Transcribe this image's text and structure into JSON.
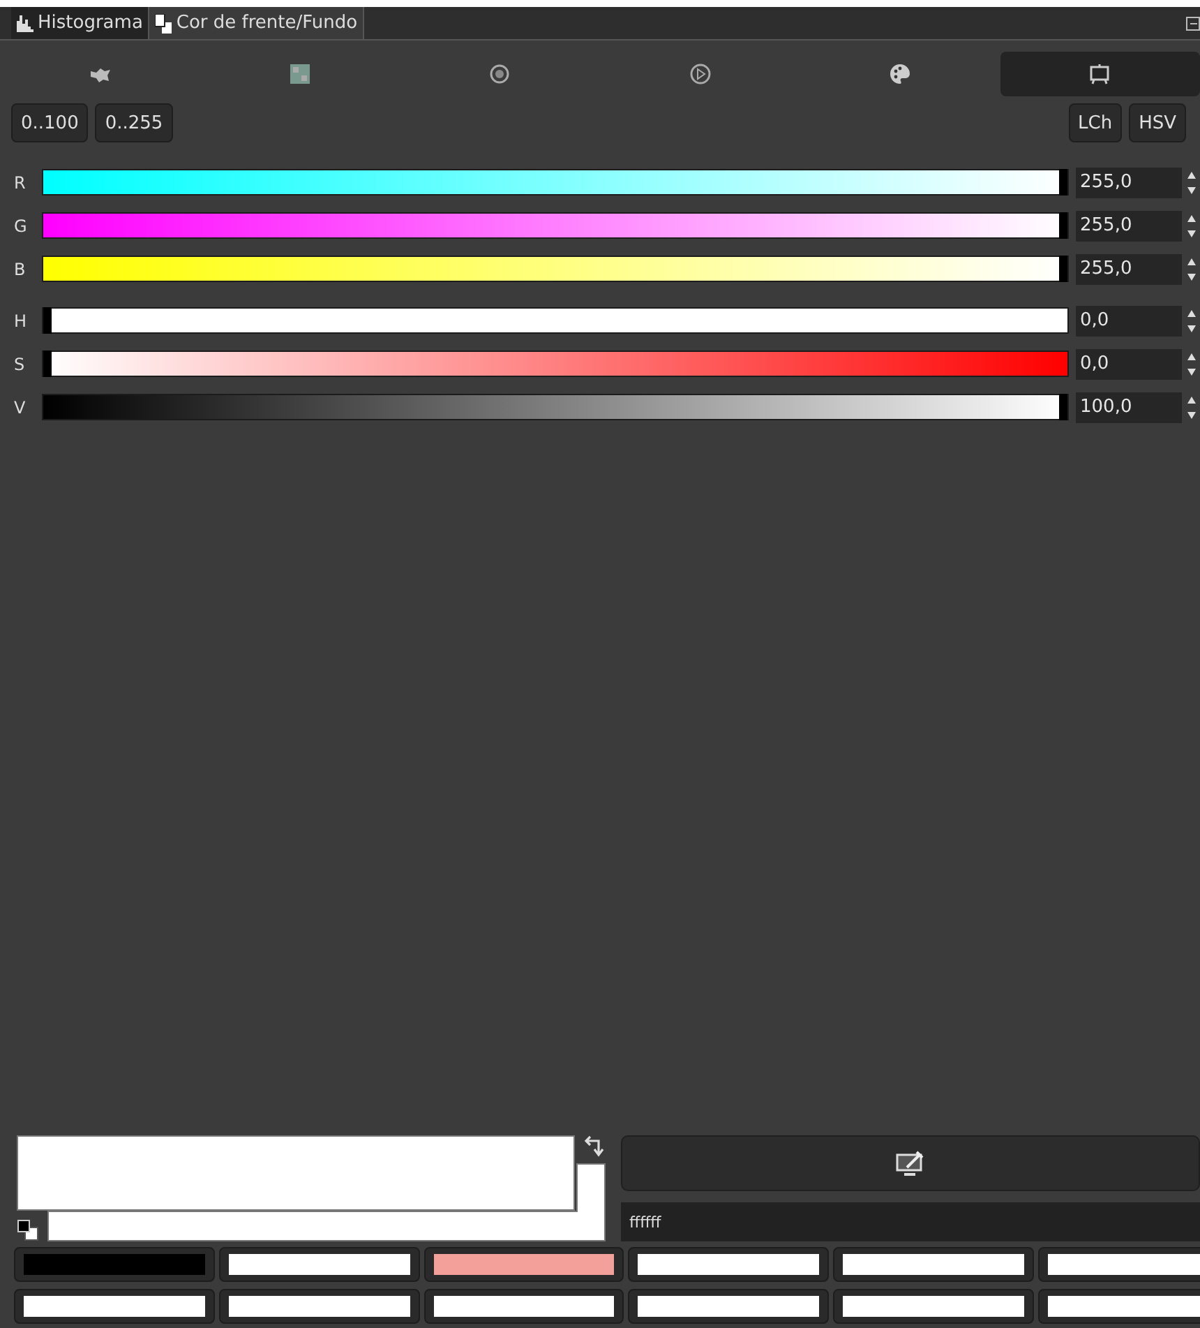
{
  "tabs": [
    {
      "label": "Histograma",
      "selected": false
    },
    {
      "label": "Cor de frente/Fundo",
      "selected": true
    }
  ],
  "selector_tabs": [
    {
      "selected": false
    },
    {
      "selected": false
    },
    {
      "selected": false
    },
    {
      "selected": false
    },
    {
      "selected": false
    },
    {
      "selected": true
    }
  ],
  "range_buttons": [
    "0..100",
    "0..255"
  ],
  "model_buttons": [
    "LCh",
    "HSV"
  ],
  "sliders": [
    {
      "label": "R",
      "value": "255,0",
      "level": 1
    },
    {
      "label": "G",
      "value": "255,0",
      "level": 1
    },
    {
      "label": "B",
      "value": "255,0",
      "level": 1
    },
    {
      "label": "H",
      "value": "0,0",
      "level": 0
    },
    {
      "label": "S",
      "value": "0,0",
      "level": 0
    },
    {
      "label": "V",
      "value": "100,0",
      "level": 1
    }
  ],
  "foreground": {
    "color": "#ffffff"
  },
  "background": {
    "color": "#ffffff"
  },
  "hex_field": {
    "value": "ffffff"
  },
  "history": [
    {
      "color": "#000000"
    },
    {
      "color": "#ffffff"
    },
    {
      "color": "#f4a09a"
    },
    {
      "color": "#ffffff"
    },
    {
      "color": "#ffffff"
    },
    {
      "color": "#ffffff"
    },
    {
      "color": "#ffffff"
    },
    {
      "color": "#ffffff"
    },
    {
      "color": "#ffffff"
    },
    {
      "color": "#ffffff"
    },
    {
      "color": "#ffffff"
    },
    {
      "color": "#ffffff"
    }
  ]
}
